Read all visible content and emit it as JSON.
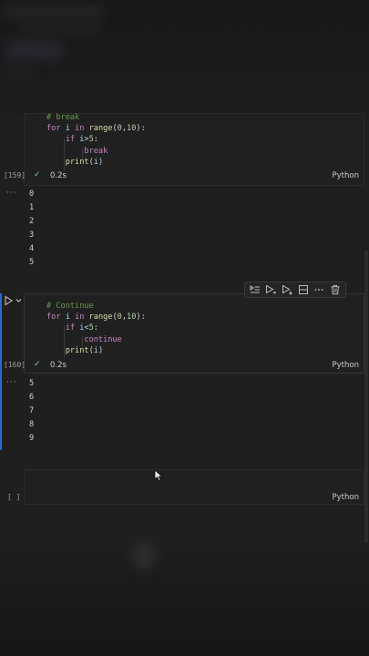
{
  "cells": [
    {
      "id": "cell-159",
      "exec_count": "[159]",
      "time": "0.2s",
      "language": "Python",
      "code_lines": [
        {
          "tokens": [
            {
              "t": "# break",
              "c": "comment"
            }
          ]
        },
        {
          "tokens": [
            {
              "t": "for",
              "c": "ctl"
            },
            {
              "t": " i ",
              "c": "var"
            },
            {
              "t": "in",
              "c": "ctl"
            },
            {
              "t": " ",
              "c": "op"
            },
            {
              "t": "range",
              "c": "fn"
            },
            {
              "t": "(",
              "c": "op"
            },
            {
              "t": "0",
              "c": "num"
            },
            {
              "t": ",",
              "c": "op"
            },
            {
              "t": "10",
              "c": "num"
            },
            {
              "t": "):",
              "c": "op"
            }
          ]
        },
        {
          "tokens": [
            {
              "t": "    ",
              "c": "op"
            },
            {
              "t": "if",
              "c": "ctl"
            },
            {
              "t": " i",
              "c": "var"
            },
            {
              "t": ">",
              "c": "op"
            },
            {
              "t": "5",
              "c": "num"
            },
            {
              "t": ":",
              "c": "op"
            }
          ]
        },
        {
          "tokens": [
            {
              "t": "        ",
              "c": "op"
            },
            {
              "t": "break",
              "c": "ctl"
            }
          ]
        },
        {
          "tokens": [
            {
              "t": "    ",
              "c": "op"
            },
            {
              "t": "print",
              "c": "fn"
            },
            {
              "t": "(",
              "c": "op"
            },
            {
              "t": "i",
              "c": "var"
            },
            {
              "t": ")",
              "c": "op"
            }
          ]
        }
      ],
      "output": [
        "0",
        "1",
        "2",
        "3",
        "4",
        "5"
      ]
    },
    {
      "id": "cell-160",
      "exec_count": "[160]",
      "time": "0.2s",
      "language": "Python",
      "code_lines": [
        {
          "tokens": [
            {
              "t": "# Continue",
              "c": "comment"
            }
          ]
        },
        {
          "tokens": [
            {
              "t": "for",
              "c": "ctl"
            },
            {
              "t": " i ",
              "c": "var"
            },
            {
              "t": "in",
              "c": "ctl"
            },
            {
              "t": " ",
              "c": "op"
            },
            {
              "t": "range",
              "c": "fn"
            },
            {
              "t": "(",
              "c": "op"
            },
            {
              "t": "0",
              "c": "num"
            },
            {
              "t": ",",
              "c": "op"
            },
            {
              "t": "10",
              "c": "num"
            },
            {
              "t": "):",
              "c": "op"
            }
          ]
        },
        {
          "tokens": [
            {
              "t": "    ",
              "c": "op"
            },
            {
              "t": "if",
              "c": "ctl"
            },
            {
              "t": " i",
              "c": "var"
            },
            {
              "t": "<",
              "c": "op"
            },
            {
              "t": "5",
              "c": "num"
            },
            {
              "t": ":",
              "c": "op"
            }
          ]
        },
        {
          "tokens": [
            {
              "t": "        ",
              "c": "op"
            },
            {
              "t": "continue",
              "c": "ctl"
            }
          ]
        },
        {
          "tokens": [
            {
              "t": "    ",
              "c": "op"
            },
            {
              "t": "print",
              "c": "fn"
            },
            {
              "t": "(",
              "c": "op"
            },
            {
              "t": "i",
              "c": "var"
            },
            {
              "t": ")",
              "c": "op"
            }
          ]
        }
      ],
      "output": [
        "5",
        "6",
        "7",
        "8",
        "9"
      ]
    },
    {
      "id": "cell-empty",
      "exec_count": "[ ]",
      "language": "Python"
    }
  ],
  "output_ellipsis": "···",
  "toolbar_icons": [
    "run-by-line-icon",
    "execute-above-icon",
    "execute-below-icon",
    "split-cell-icon",
    "more-actions-icon",
    "delete-cell-icon"
  ],
  "colors": {
    "background": "#1f1f1f",
    "focus": "#1f6fd1",
    "success": "#89d185",
    "comment": "#6a9955",
    "keyword_control": "#c586c0",
    "function": "#dcdcaa",
    "number": "#b5cea8",
    "variable": "#9cdcfe"
  }
}
